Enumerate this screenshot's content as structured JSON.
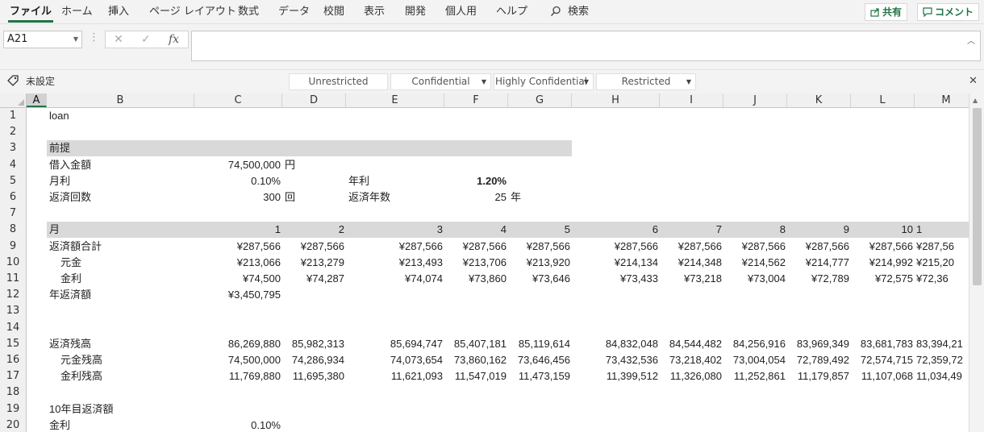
{
  "ribbon": {
    "tabs": [
      {
        "label": "ファイル",
        "active": true
      },
      {
        "label": "ホーム"
      },
      {
        "label": "挿入"
      },
      {
        "label": "ページ レイアウト"
      },
      {
        "label": "数式"
      },
      {
        "label": "データ"
      },
      {
        "label": "校閲"
      },
      {
        "label": "表示"
      },
      {
        "label": "開発"
      },
      {
        "label": "個人用"
      },
      {
        "label": "ヘルプ"
      }
    ],
    "search_label": "検索",
    "share_label": "共有",
    "comment_label": "コメント",
    "accent_color": "#217346"
  },
  "formula_bar": {
    "name_box": "A21",
    "fx_label": "fx",
    "value": ""
  },
  "sensitivity": {
    "current": "未設定",
    "options": [
      {
        "label": "Unrestricted"
      },
      {
        "label": "Confidential"
      },
      {
        "label": "Highly Confidential"
      },
      {
        "label": "Restricted"
      }
    ]
  },
  "grid": {
    "columns": [
      "A",
      "B",
      "C",
      "D",
      "E",
      "F",
      "G",
      "H",
      "I",
      "J",
      "K",
      "L",
      "M"
    ],
    "selected_column": "A",
    "rows": [
      "1",
      "2",
      "3",
      "4",
      "5",
      "6",
      "7",
      "8",
      "9",
      "10",
      "11",
      "12",
      "13",
      "14",
      "15",
      "16",
      "17",
      "18",
      "19",
      "20"
    ],
    "cells": {
      "B1": "loan",
      "B3": "前提",
      "B4": "借入金額",
      "C4": "74,500,000",
      "D4": "円",
      "B5": "月利",
      "C5": "0.10%",
      "E5": "年利",
      "F5": "1.20%",
      "B6": "返済回数",
      "C6": "300",
      "D6": "回",
      "E6": "返済年数",
      "F6": "25",
      "G6": "年",
      "B8": "月",
      "C8": "1",
      "D8": "2",
      "E8": "3",
      "F8": "4",
      "G8": "5",
      "H8": "6",
      "I8": "7",
      "J8": "8",
      "K8": "9",
      "L8": "10",
      "M8": "1",
      "B9": "返済額合計",
      "C9": "¥287,566",
      "D9": "¥287,566",
      "E9": "¥287,566",
      "F9": "¥287,566",
      "G9": "¥287,566",
      "H9": "¥287,566",
      "I9": "¥287,566",
      "J9": "¥287,566",
      "K9": "¥287,566",
      "L9": "¥287,566",
      "M9": "¥287,56",
      "B10": "元金",
      "C10": "¥213,066",
      "D10": "¥213,279",
      "E10": "¥213,493",
      "F10": "¥213,706",
      "G10": "¥213,920",
      "H10": "¥214,134",
      "I10": "¥214,348",
      "J10": "¥214,562",
      "K10": "¥214,777",
      "L10": "¥214,992",
      "M10": "¥215,20",
      "B11": "金利",
      "C11": "¥74,500",
      "D11": "¥74,287",
      "E11": "¥74,074",
      "F11": "¥73,860",
      "G11": "¥73,646",
      "H11": "¥73,433",
      "I11": "¥73,218",
      "J11": "¥73,004",
      "K11": "¥72,789",
      "L11": "¥72,575",
      "M11": "¥72,36",
      "B12": "年返済額",
      "C12": "¥3,450,795",
      "B15": "返済残高",
      "C15": "86,269,880",
      "D15": "85,982,313",
      "E15": "85,694,747",
      "F15": "85,407,181",
      "G15": "85,119,614",
      "H15": "84,832,048",
      "I15": "84,544,482",
      "J15": "84,256,916",
      "K15": "83,969,349",
      "L15": "83,681,783",
      "M15": "83,394,21",
      "B16": "元金残高",
      "C16": "74,500,000",
      "D16": "74,286,934",
      "E16": "74,073,654",
      "F16": "73,860,162",
      "G16": "73,646,456",
      "H16": "73,432,536",
      "I16": "73,218,402",
      "J16": "73,004,054",
      "K16": "72,789,492",
      "L16": "72,574,715",
      "M16": "72,359,72",
      "B17": "金利残高",
      "C17": "11,769,880",
      "D17": "11,695,380",
      "E17": "11,621,093",
      "F17": "11,547,019",
      "G17": "11,473,159",
      "H17": "11,399,512",
      "I17": "11,326,080",
      "J17": "11,252,861",
      "K17": "11,179,857",
      "L17": "11,107,068",
      "M17": "11,034,49",
      "B19": "10年目返済額",
      "B20": "金利",
      "C20": "0.10%"
    }
  }
}
